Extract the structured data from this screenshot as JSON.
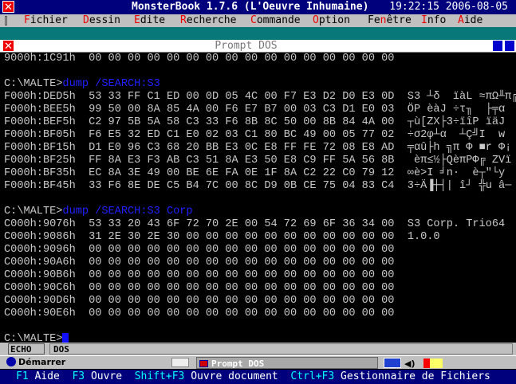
{
  "title": "MonsterBook 1.7.6 (L'Oeuvre Inhumaine)",
  "clock": "19:22:15 2006-08-05",
  "menu": [
    {
      "hot": "F",
      "rest": "ichier"
    },
    {
      "hot": "D",
      "rest": "essin"
    },
    {
      "hot": "E",
      "rest": "dite"
    },
    {
      "hot": "R",
      "rest": "echerche"
    },
    {
      "hot": "C",
      "rest": "ommande"
    },
    {
      "hot": "O",
      "rest": "ption"
    },
    {
      "pre": "Fe",
      "hot": "n",
      "rest": "être"
    },
    {
      "hot": "I",
      "rest": "nfo"
    },
    {
      "hot": "A",
      "rest": "ide"
    }
  ],
  "window_title": "Prompt DOS",
  "terminal": {
    "top_line": {
      "addr": "9000h:1C91h",
      "hex": "00 00 00 00 00 00 00 00 00 00 00 00 00 00 00 00",
      "ascii": ""
    },
    "prompt": "C:\\MALTE>",
    "cmd1": "dump /SEARCH:S3",
    "block1": [
      {
        "addr": "F000h:DED5h",
        "hex": "53 33 FF C1 ED 00 0D 05 4C 00 F7 E3 D2 D0 E3 0D",
        "ascii": "S3 ┴δ  ïàL ≈πΩ╨π╔"
      },
      {
        "addr": "F000h:BEE5h",
        "hex": "99 50 00 8A 85 4A 00 F6 E7 B7 00 03 C3 D1 E0 03",
        "ascii": "ÖP èàJ ÷τ╖  ├╤α"
      },
      {
        "addr": "F000h:BEF5h",
        "hex": "C2 97 5B 5A 58 C3 33 F6 8B 8C 50 00 8B 84 4A 00",
        "ascii": "┬ù[ZX├3÷ïîP ïäJ"
      },
      {
        "addr": "F000h:BF05h",
        "hex": "F6 E5 32 ED C1 E0 02 03 C1 80 BC 49 00 05 77 02",
        "ascii": "÷σ2φ┴α  ┴Ç╝I  w"
      },
      {
        "addr": "F000h:BF15h",
        "hex": "D1 E0 96 C3 68 20 BB E3 0C E8 FF FE 72 08 E8 AD",
        "ascii": "╤αû├h ╗π Φ ■r Φ¡"
      },
      {
        "addr": "F000h:BF25h",
        "hex": "FF 8A E3 F3 AB C3 51 8A E3 50 E8 C9 FF 5A 56 8B",
        "ascii": " èπ≤½├QèπPΦ╔ ZVï"
      },
      {
        "addr": "F000h:BF35h",
        "hex": "EC 8A 3E 49 00 BE 6E FA 0E 1F 8A C2 22 C0 79 12",
        "ascii": "∞è>I ╛n·  è┬\"└y"
      },
      {
        "addr": "F000h:BF45h",
        "hex": "33 F6 8E DE C5 B4 7C 00 8C D9 0B CE 75 04 83 C4",
        "ascii": "3÷Ä▐┼┤| î┘ ╬u â─"
      }
    ],
    "cmd2": "dump /SEARCH:S3 Corp",
    "block2": [
      {
        "addr": "C000h:9076h",
        "hex": "53 33 20 43 6F 72 70 2E 00 54 72 69 6F 36 34 00",
        "ascii": "S3 Corp. Trio64"
      },
      {
        "addr": "C000h:9086h",
        "hex": "31 2E 30 2E 30 00 00 00 00 00 00 00 00 00 00 00",
        "ascii": "1.0.0"
      },
      {
        "addr": "C000h:9096h",
        "hex": "00 00 00 00 00 00 00 00 00 00 00 00 00 00 00 00",
        "ascii": ""
      },
      {
        "addr": "C000h:90A6h",
        "hex": "00 00 00 00 00 00 00 00 00 00 00 00 00 00 00 00",
        "ascii": ""
      },
      {
        "addr": "C000h:90B6h",
        "hex": "00 00 00 00 00 00 00 00 00 00 00 00 00 00 00 00",
        "ascii": ""
      },
      {
        "addr": "C000h:90C6h",
        "hex": "00 00 00 00 00 00 00 00 00 00 00 00 00 00 00 00",
        "ascii": ""
      },
      {
        "addr": "C000h:90D6h",
        "hex": "00 00 00 00 00 00 00 00 00 00 00 00 00 00 00 00",
        "ascii": ""
      },
      {
        "addr": "C000h:90E6h",
        "hex": "00 00 00 00 00 00 00 00 00 00 00 00 00 00 00 00",
        "ascii": ""
      }
    ]
  },
  "status": {
    "echo": "ECHO",
    "mode": "DOS"
  },
  "taskbar": {
    "start": "Démarrer",
    "task": "Prompt DOS"
  },
  "fkeys": [
    {
      "key": "F1",
      "label": "Aide"
    },
    {
      "key": "F3",
      "label": "Ouvre"
    },
    {
      "key": "Shift+F3",
      "label": "Ouvre document"
    },
    {
      "key": "Ctrl+F3",
      "label": "Gestionnaire de Fichiers"
    }
  ]
}
